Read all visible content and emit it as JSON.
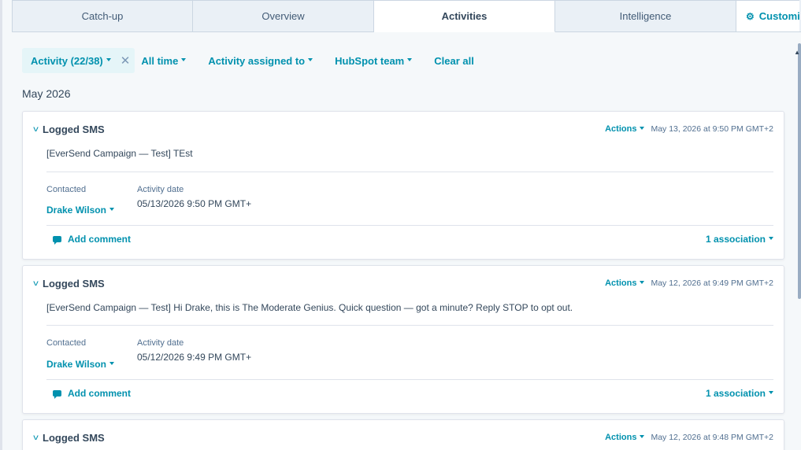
{
  "tabs": [
    {
      "label": "Catch-up"
    },
    {
      "label": "Overview"
    },
    {
      "label": "Activities"
    },
    {
      "label": "Intelligence"
    },
    {
      "label": "Customi"
    }
  ],
  "filters": {
    "activity": "Activity (22/38)",
    "time": "All time",
    "assigned": "Activity assigned to",
    "team": "HubSpot team",
    "clear": "Clear all"
  },
  "month": "May 2026",
  "labels": {
    "contacted": "Contacted",
    "activity_date": "Activity date",
    "add_comment": "Add comment",
    "actions": "Actions"
  },
  "activities": [
    {
      "title": "Logged SMS",
      "timestamp": "May 13, 2026 at 9:50 PM GMT+2",
      "body": "[EverSend Campaign — Test] TEst",
      "contact": "Drake Wilson",
      "date": "05/13/2026 9:50 PM GMT+",
      "associations": "1 association"
    },
    {
      "title": "Logged SMS",
      "timestamp": "May 12, 2026 at 9:49 PM GMT+2",
      "body": "[EverSend Campaign — Test] Hi Drake, this is The Moderate Genius. Quick question — got a minute? Reply STOP to opt out.",
      "contact": "Drake Wilson",
      "date": "05/12/2026 9:49 PM GMT+",
      "associations": "1 association"
    },
    {
      "title": "Logged SMS",
      "timestamp": "May 12, 2026 at 9:48 PM GMT+2"
    }
  ]
}
